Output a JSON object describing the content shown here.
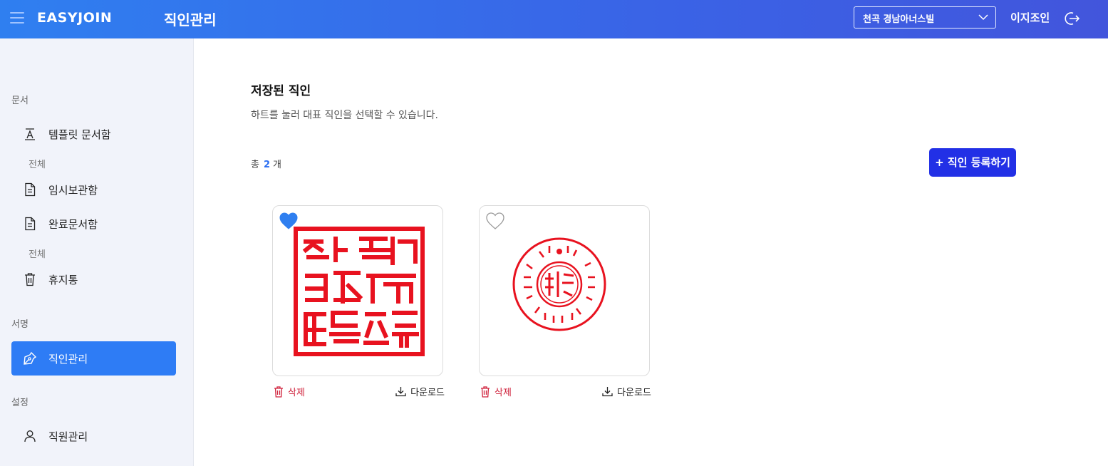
{
  "app": {
    "logo": "EASYJOIN",
    "page_title": "직인관리"
  },
  "header": {
    "company_select": "천곡 경남아너스빌",
    "user_name": "이지조인"
  },
  "sidebar": {
    "sections": [
      {
        "label": "문서"
      },
      {
        "label": "서명"
      },
      {
        "label": "설정"
      }
    ],
    "items": [
      {
        "label": "템플릿 문서함",
        "sub": "전체"
      },
      {
        "label": "임시보관함"
      },
      {
        "label": "완료문서함",
        "sub": "전체"
      },
      {
        "label": "휴지통"
      },
      {
        "label": "직인관리"
      },
      {
        "label": "직원관리"
      }
    ]
  },
  "main": {
    "title": "저장된 직인",
    "description": "하트를 눌러 대표 직인을 선택할 수 있습니다.",
    "count_prefix": "총",
    "count_value": "2",
    "count_suffix": "개",
    "register_button": "+ 직인 등록하기",
    "seals": [
      {
        "favorite": true,
        "delete_label": "삭제",
        "download_label": "다운로드"
      },
      {
        "favorite": false,
        "delete_label": "삭제",
        "download_label": "다운로드"
      }
    ]
  },
  "colors": {
    "accent": "#2e7cf5",
    "primary_button": "#2230e6",
    "danger": "#d0223c",
    "seal_red": "#e8121f"
  }
}
